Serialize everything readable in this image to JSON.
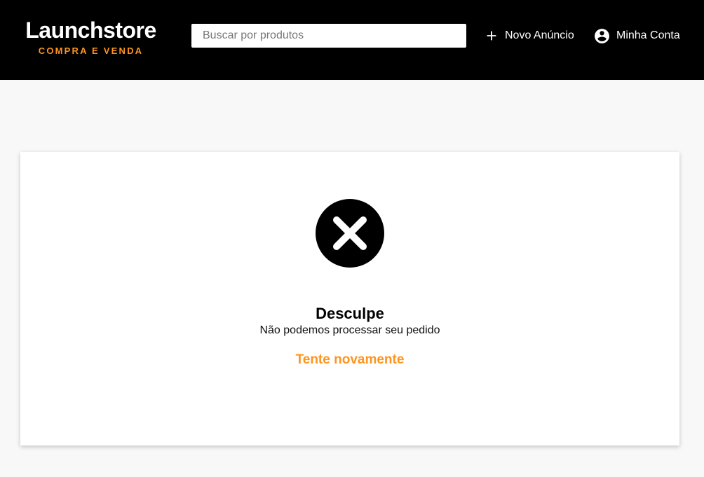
{
  "header": {
    "logo": {
      "title": "Launchstore",
      "subtitle": "COMPRA E VENDA"
    },
    "search": {
      "placeholder": "Buscar por produtos",
      "value": ""
    },
    "nav": {
      "new_ad_label": "Novo Anúncio",
      "new_ad_icon": "plus-icon",
      "account_label": "Minha Conta",
      "account_icon": "account-circle-icon"
    }
  },
  "error_card": {
    "icon": "cancel-icon",
    "title": "Desculpe",
    "message": "Não podemos processar seu pedido",
    "retry_label": "Tente novamente"
  },
  "colors": {
    "header_bg": "#000000",
    "accent": "#fd951f",
    "page_bg": "#f8f8f8",
    "card_bg": "#ffffff"
  }
}
